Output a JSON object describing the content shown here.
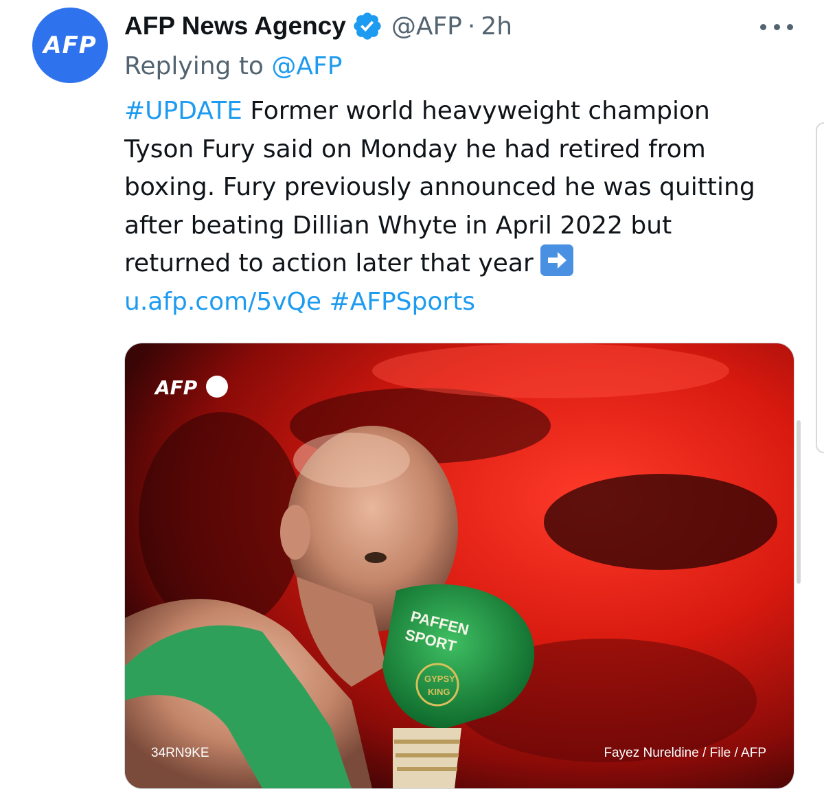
{
  "tweet": {
    "avatar_text": "AFP",
    "display_name": "AFP News Agency",
    "handle": "@AFP",
    "separator": "·",
    "time": "2h",
    "reply_prefix": "Replying to ",
    "reply_handle": "@AFP",
    "body": {
      "hashtag_update": "#UPDATE",
      "line1_rest": " Former world heavyweight champion",
      "line2": "Tyson Fury said on Monday he had retired from",
      "line3": "boxing. Fury previously announced he was quitting",
      "line4": "after beating Dillian Whyte in April 2022 but",
      "line5": "returned to action later that year",
      "link_url": "u.afp.com/5vQe",
      "hashtag_sports": "#AFPSports"
    },
    "emoji_name": "right-arrow-emoji",
    "media": {
      "watermark": "AFP",
      "photo_id": "34RN9KE",
      "credit": "Fayez Nureldine / File / AFP",
      "glove_text_1": "PAFFEN",
      "glove_text_2": "SPORT",
      "glove_badge_1": "GYPSY",
      "glove_badge_2": "KING"
    }
  },
  "colors": {
    "accent": "#1d9bf0",
    "avatar_bg": "#2f72ee",
    "secondary_text": "#536471",
    "verified": "#1d9bf0"
  }
}
